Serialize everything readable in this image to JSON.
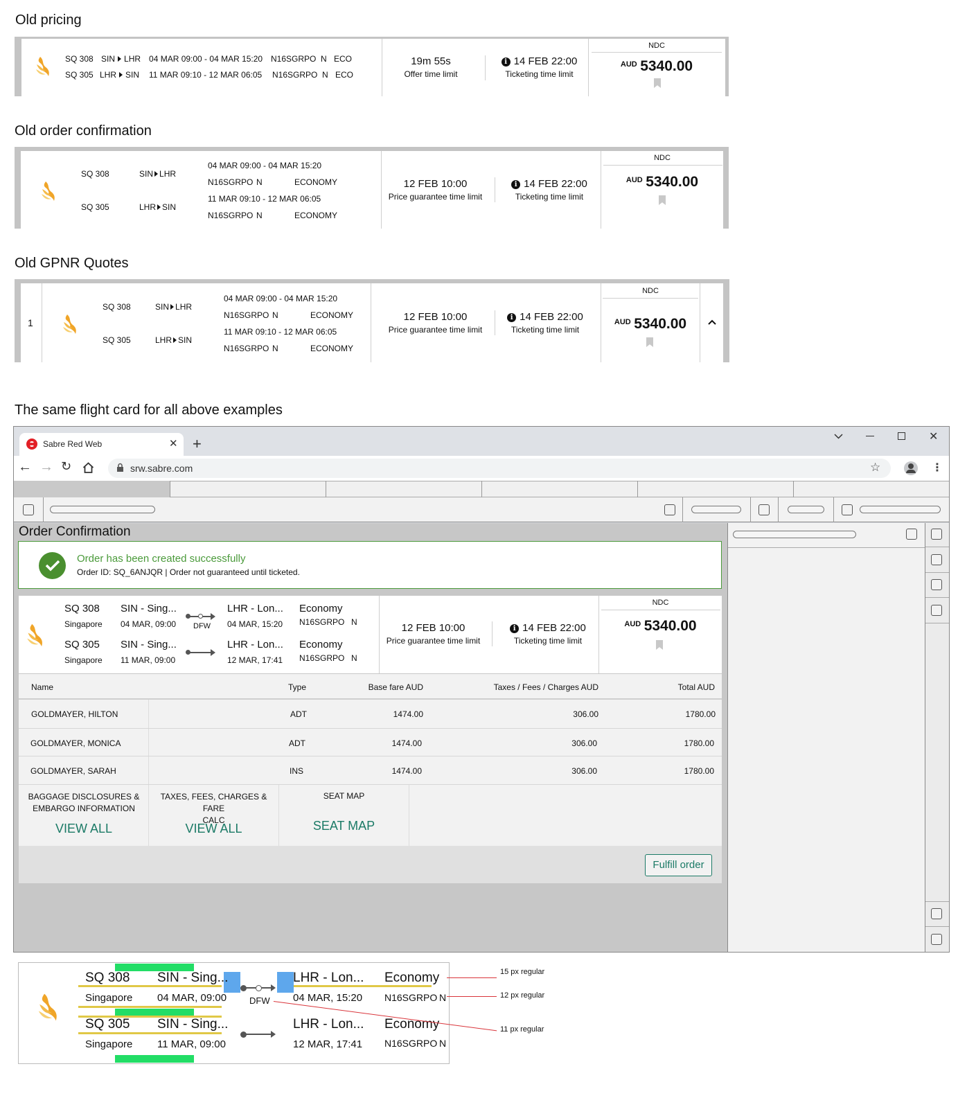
{
  "headings": {
    "old_pricing": "Old pricing",
    "old_order": "Old order confirmation",
    "old_gpnr": "Old GPNR Quotes",
    "same_card": "The same flight card for all above examples"
  },
  "old_pricing": {
    "segments": [
      {
        "flight": "SQ 308",
        "from": "SIN",
        "to": "LHR",
        "times": "04 MAR 09:00  -  04 MAR 15:20",
        "pnr": "N16SGRPO",
        "class": "N",
        "cabin": "ECO"
      },
      {
        "flight": "SQ 305",
        "from": "LHR",
        "to": "SIN",
        "times": "11 MAR 09:10  -  12 MAR 06:05",
        "pnr": "N16SGRPO",
        "class": "N",
        "cabin": "ECO"
      }
    ],
    "offer_time": "19m 55s",
    "offer_label": "Offer time limit",
    "ticket_time": "14 FEB 22:00",
    "ticket_label": "Ticketing time limit",
    "source": "NDC",
    "currency": "AUD",
    "price": "5340.00"
  },
  "old_order": {
    "flights": [
      "SQ 308",
      "SQ 305"
    ],
    "routes": [
      {
        "from": "SIN",
        "to": "LHR"
      },
      {
        "from": "LHR",
        "to": "SIN"
      }
    ],
    "lines": [
      "04 MAR 09:00 - 04 MAR 15:20",
      "11 MAR 09:10 - 12 MAR 06:05"
    ],
    "pnr": "N16SGRPO",
    "class": "N",
    "cabin": "ECONOMY",
    "price_time": "12 FEB 10:00",
    "price_label": "Price guarantee time limit",
    "ticket_time": "14 FEB 22:00",
    "ticket_label": "Ticketing time limit",
    "source": "NDC",
    "currency": "AUD",
    "price": "5340.00"
  },
  "old_gpnr": {
    "index": "1",
    "flights": [
      "SQ 308",
      "SQ 305"
    ],
    "routes": [
      {
        "from": "SIN",
        "to": "LHR"
      },
      {
        "from": "LHR",
        "to": "SIN"
      }
    ],
    "lines": [
      "04 MAR 09:00 - 04 MAR 15:20",
      "11 MAR 09:10 - 12 MAR 06:05"
    ],
    "pnr": "N16SGRPO",
    "class": "N",
    "cabin": "ECONOMY",
    "price_time": "12 FEB 10:00",
    "price_label": "Price guarantee time limit",
    "ticket_time": "14 FEB 22:00",
    "ticket_label": "Ticketing time limit",
    "source": "NDC",
    "currency": "AUD",
    "price": "5340.00"
  },
  "browser": {
    "tab_title": "Sabre Red Web",
    "url": "srw.sabre.com"
  },
  "app": {
    "title": "Order Confirmation",
    "success_title": "Order has been created successfully",
    "success_sub": "Order ID: SQ_6ANJQR | Order not guaranteed until ticketed.",
    "card": {
      "segments": [
        {
          "flight": "SQ 308",
          "origin_city": "Singapore",
          "from": "SIN - Sing...",
          "depart": "04 MAR, 09:00",
          "stop": "DFW",
          "to": "LHR - Lon...",
          "arrive": "04 MAR, 15:20",
          "cabin": "Economy",
          "pnr": "N16SGRPO",
          "class": "N"
        },
        {
          "flight": "SQ 305",
          "origin_city": "Singapore",
          "from": "SIN - Sing...",
          "depart": "11 MAR, 09:00",
          "to": "LHR - Lon...",
          "arrive": "12 MAR, 17:41",
          "cabin": "Economy",
          "pnr": "N16SGRPO",
          "class": "N"
        }
      ],
      "price_time": "12 FEB 10:00",
      "price_label": "Price guarantee time limit",
      "ticket_time": "14 FEB 22:00",
      "ticket_label": "Ticketing time limit",
      "source": "NDC",
      "currency": "AUD",
      "price": "5340.00"
    },
    "table": {
      "headers": [
        "Name",
        "Type",
        "Base fare AUD",
        "Taxes / Fees / Charges AUD",
        "Total AUD"
      ],
      "rows": [
        [
          "GOLDMAYER, HILTON",
          "ADT",
          "1474.00",
          "306.00",
          "1780.00"
        ],
        [
          "GOLDMAYER, MONICA",
          "ADT",
          "1474.00",
          "306.00",
          "1780.00"
        ],
        [
          "GOLDMAYER, SARAH",
          "INS",
          "1474.00",
          "306.00",
          "1780.00"
        ]
      ]
    },
    "links": [
      {
        "title_1": "BAGGAGE DISCLOSURES &",
        "title_2": "EMBARGO INFORMATION",
        "action": "VIEW ALL"
      },
      {
        "title_1": "TAXES, FEES, CHARGES & FARE",
        "title_2": "CALC",
        "action": "VIEW ALL"
      },
      {
        "title_1": "SEAT MAP",
        "title_2": "",
        "action": "SEAT MAP"
      }
    ],
    "fulfill": "Fulfill order"
  },
  "spec": {
    "segments": [
      {
        "flight": "SQ 308",
        "origin_city": "Singapore",
        "from": "SIN - Sing...",
        "depart": "04 MAR, 09:00",
        "stop": "DFW",
        "to": "LHR - Lon...",
        "arrive": "04 MAR, 15:20",
        "cabin": "Economy",
        "pnr": "N16SGRPO",
        "class": "N"
      },
      {
        "flight": "SQ 305",
        "origin_city": "Singapore",
        "from": "SIN - Sing...",
        "depart": "11 MAR, 09:00",
        "to": "LHR - Lon...",
        "arrive": "12 MAR, 17:41",
        "cabin": "Economy",
        "pnr": "N16SGRPO",
        "class": "N"
      }
    ],
    "annotations": [
      "15 px regular",
      "12 px regular",
      "11 px regular"
    ],
    "colors": {
      "highlight_green": "#22dd66",
      "highlight_yellow": "#e0c846",
      "spacer_blue": "#5ea7ec",
      "annotation_red": "#d9343a"
    }
  }
}
